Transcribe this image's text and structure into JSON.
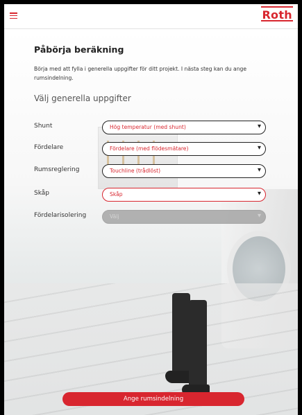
{
  "header": {
    "menu_icon": "hamburger-menu-icon",
    "logo_text": "Roth"
  },
  "main": {
    "title": "Påbörja beräkning",
    "intro": "Börja med att fylla i generella uppgifter för ditt projekt. I nästa steg kan du ange rumsindelning.",
    "section_title": "Välj generella uppgifter",
    "fields": [
      {
        "label": "Shunt",
        "value": "Hög temperatur (med shunt)"
      },
      {
        "label": "Fördelare",
        "value": "Fördelare (med flödesmätare)"
      },
      {
        "label": "Rumsreglering",
        "value": "Touchline (trådlöst)"
      },
      {
        "label": "Skåp",
        "value": "Skåp"
      },
      {
        "label": "Fördelarisolering",
        "value": "Välj"
      }
    ],
    "cta_label": "Ange rumsindelning"
  },
  "colors": {
    "accent": "#d8262f",
    "field_border": "#222222",
    "disabled": "#a6a6a6"
  }
}
